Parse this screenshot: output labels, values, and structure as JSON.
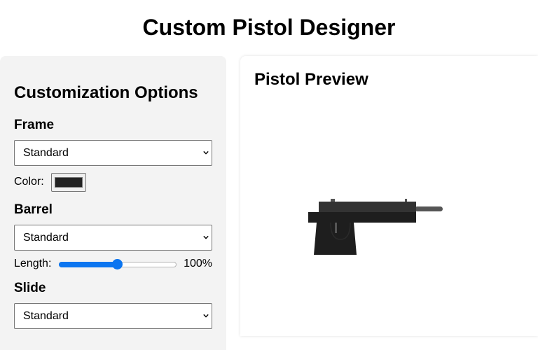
{
  "page": {
    "title": "Custom Pistol Designer"
  },
  "options": {
    "heading": "Customization Options",
    "frame": {
      "heading": "Frame",
      "selected": "Standard",
      "color_label": "Color:",
      "color_value": "#222222"
    },
    "barrel": {
      "heading": "Barrel",
      "selected": "Standard",
      "length_label": "Length:",
      "length_value": "100%",
      "length_fraction": 0.5
    },
    "slide": {
      "heading": "Slide",
      "selected": "Standard"
    }
  },
  "preview": {
    "heading": "Pistol Preview",
    "colors": {
      "frame": "#1e1e1e",
      "slide": "#333333",
      "barrel": "#555555",
      "grip": "#1e1e1e"
    }
  },
  "icons": {
    "select_arrow": "chevron-down-icon"
  },
  "colors": {
    "panel_bg": "#f3f3f3",
    "accent": "#0b75f0"
  }
}
